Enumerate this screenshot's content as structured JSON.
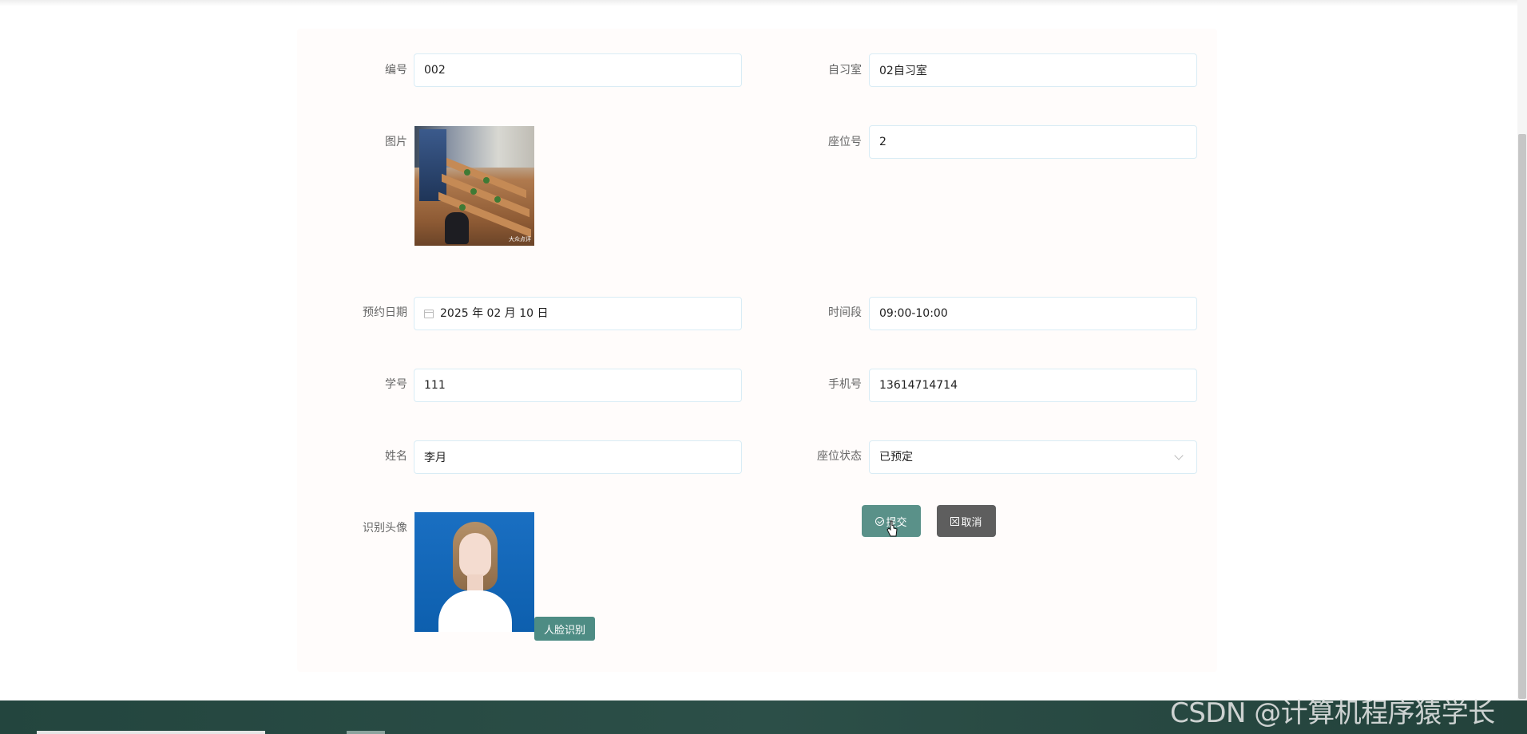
{
  "form": {
    "fields": {
      "number": {
        "label": "编号",
        "value": "002"
      },
      "study_room": {
        "label": "自习室",
        "value": "02自习室"
      },
      "image": {
        "label": "图片",
        "watermark": "大众点评"
      },
      "seat_no": {
        "label": "座位号",
        "value": "2"
      },
      "booking_date": {
        "label": "预约日期",
        "value": "2025 年 02 月 10 日"
      },
      "time_slot": {
        "label": "时间段",
        "value": "09:00-10:00"
      },
      "student_id": {
        "label": "学号",
        "value": "111"
      },
      "phone": {
        "label": "手机号",
        "value": "13614714714"
      },
      "name": {
        "label": "姓名",
        "value": "李月"
      },
      "seat_status": {
        "label": "座位状态",
        "value": "已预定"
      },
      "face_image": {
        "label": "识别头像"
      }
    },
    "face_recognition_button": "人脸识别",
    "submit_label": "提交",
    "cancel_label": "取消"
  },
  "watermark": "CSDN @计算机程序猿学长",
  "colors": {
    "submit": "#5a9189",
    "cancel": "#5e5e5e",
    "face_button": "#4e8c84",
    "footer": "#2c4f48",
    "input_border": "#d9ecf5"
  }
}
